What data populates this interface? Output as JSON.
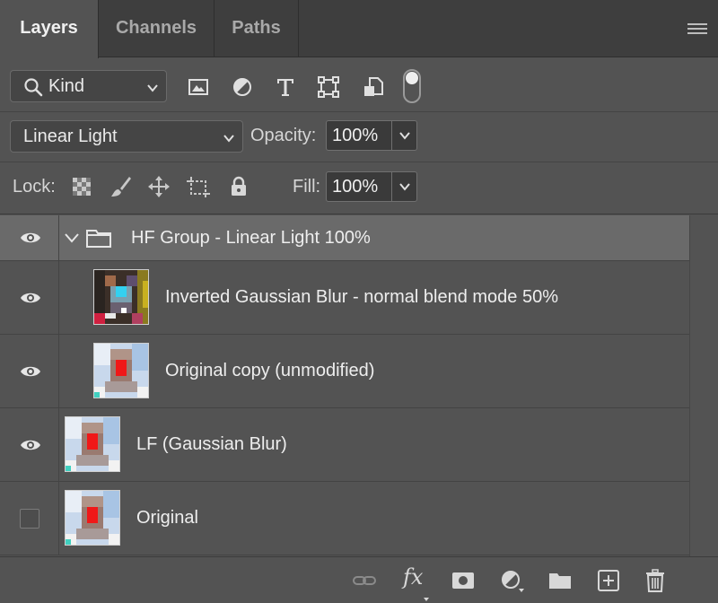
{
  "tabs": [
    {
      "label": "Layers",
      "active": true
    },
    {
      "label": "Channels",
      "active": false
    },
    {
      "label": "Paths",
      "active": false
    }
  ],
  "filter": {
    "kind_label": "Kind",
    "icons": [
      "image-filter-icon",
      "adjustment-filter-icon",
      "type-filter-icon",
      "shape-filter-icon",
      "smart-object-filter-icon"
    ],
    "filter_toggle_on": true
  },
  "blend": {
    "mode": "Linear Light",
    "opacity_label": "Opacity:",
    "opacity_value": "100%"
  },
  "lock": {
    "label": "Lock:",
    "fill_label": "Fill:",
    "fill_value": "100%"
  },
  "layers": [
    {
      "name": "HF Group - Linear Light 100%",
      "type": "group",
      "visible": true,
      "selected": true
    },
    {
      "name": "Inverted Gaussian Blur - normal blend mode 50%",
      "type": "pixel",
      "visible": true
    },
    {
      "name": "Original copy (unmodified)",
      "type": "pixel",
      "visible": true
    },
    {
      "name": "LF (Gaussian Blur)",
      "type": "pixel",
      "visible": true
    },
    {
      "name": "Original",
      "type": "pixel",
      "visible": false
    }
  ],
  "bottom": {
    "fx_label": "fx"
  },
  "colors": {
    "panel": "#535353",
    "tab_bar": "#3e3e3e",
    "selected_row": "#6a6a6a",
    "text": "#eeeeee"
  }
}
